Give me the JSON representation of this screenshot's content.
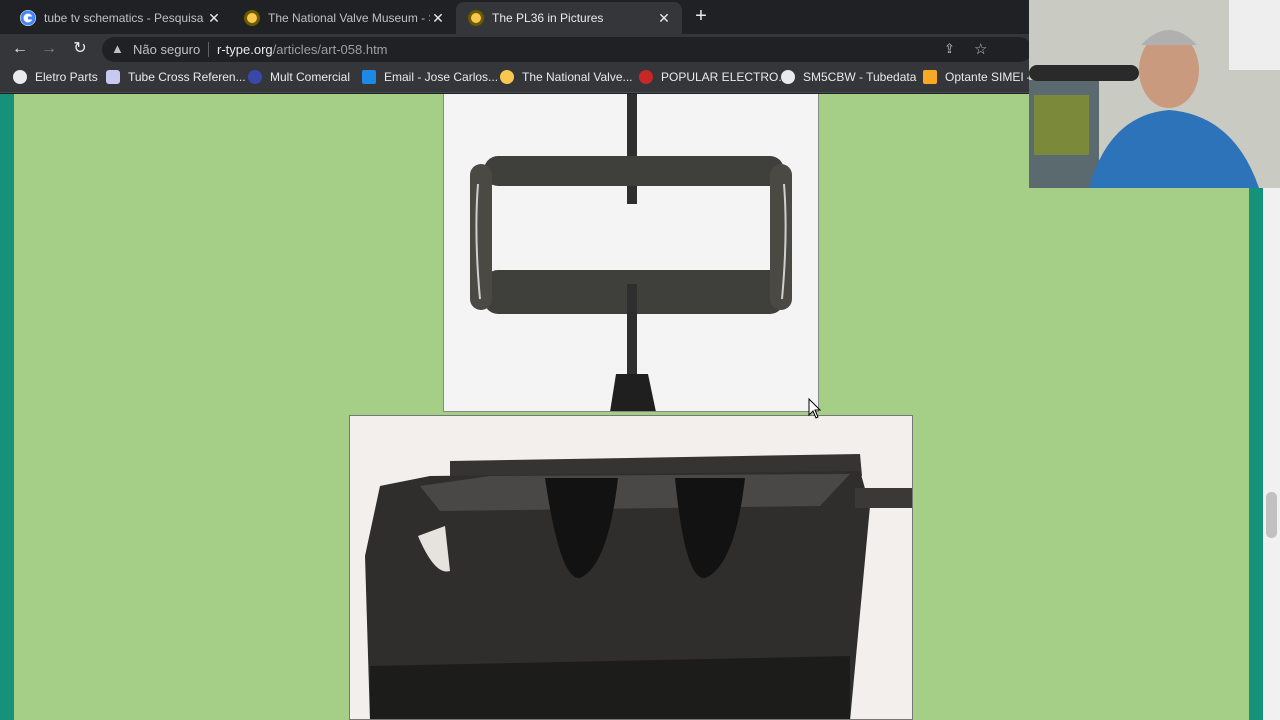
{
  "tabs": [
    {
      "title": "tube tv schematics - Pesquisa Go",
      "icon": "google-icon"
    },
    {
      "title": "The National Valve Museum - Se",
      "icon": "valve-icon"
    },
    {
      "title": "The PL36 in Pictures",
      "icon": "valve-icon"
    }
  ],
  "toolbar": {
    "security_label": "Não seguro",
    "url_host": "r-type.org",
    "url_path": "/articles/art-058.htm"
  },
  "bookmarks": [
    {
      "label": "Eletro Parts",
      "icon": "globe-icon"
    },
    {
      "label": "Tube Cross Referen...",
      "icon": "tube-icon"
    },
    {
      "label": "Mult Comercial",
      "icon": "m-icon"
    },
    {
      "label": "Email - Jose Carlos...",
      "icon": "outlook-icon"
    },
    {
      "label": "The National Valve...",
      "icon": "valve-icon"
    },
    {
      "label": "POPULAR ELECTRO...",
      "icon": "pin-icon"
    },
    {
      "label": "SM5CBW - Tubedata",
      "icon": "globe-icon"
    },
    {
      "label": "Optante SIMEI –",
      "icon": "arrow-icon"
    }
  ],
  "colors": {
    "page_bg": "#a5cf87",
    "side_bars": "#16927a",
    "chrome_dark": "#202124",
    "chrome_toolbar": "#35363a"
  }
}
